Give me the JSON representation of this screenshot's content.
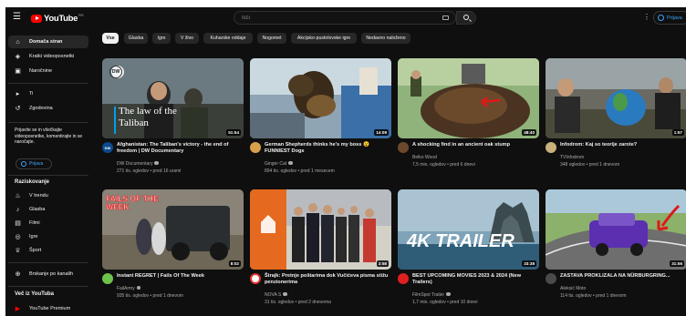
{
  "header": {
    "logo_text": "YouTube",
    "logo_region": "RS",
    "search_placeholder": "Išči",
    "signin_label": "Prijava"
  },
  "sidebar": {
    "items": [
      {
        "label": "Domača stran",
        "icon": "home-icon"
      },
      {
        "label": "Kratki videoposnetki",
        "icon": "shorts-icon"
      },
      {
        "label": "Naročnine",
        "icon": "subscriptions-icon"
      },
      {
        "label": "Ti",
        "icon": "you-icon"
      },
      {
        "label": "Zgodovina",
        "icon": "history-icon"
      }
    ],
    "signin_hint": "Prijavite se in všečkajte videoposnetke, komentirajte in se naročajte.",
    "signin_label": "Prijava",
    "explore_title": "Raziskovanje",
    "explore_items": [
      {
        "label": "V trendu",
        "icon": "trending-icon"
      },
      {
        "label": "Glasba",
        "icon": "music-icon"
      },
      {
        "label": "Filmi",
        "icon": "movies-icon"
      },
      {
        "label": "Igre",
        "icon": "gaming-icon"
      },
      {
        "label": "Šport",
        "icon": "sports-icon"
      }
    ],
    "browse_channels": "Brskanje po kanalih",
    "more_title": "Več iz YouTuba",
    "premium_label": "YouTube Premium"
  },
  "chips": [
    "Vse",
    "Glasba",
    "Igre",
    "V živo",
    "Kuharske oddaje",
    "Nogomet",
    "Akcijsko-pustolovske igre",
    "Nedavno naloženo"
  ],
  "videos": [
    {
      "title": "Afghanistan: The Taliban's victory - the end of freedom | DW Documentary",
      "channel": "DW Documentary",
      "verified": true,
      "meta": "271 tis. ogledov • pred 16 urami",
      "duration": "51:54",
      "thumb_caption": "The law of the Taliban",
      "avatar_text": "DW"
    },
    {
      "title": "German Shepherds thinks he's my boss 😮 FUNNIEST Dogs",
      "channel": "Ginger Cat",
      "verified": true,
      "meta": "894 tis. ogledov • pred 1 mesecem",
      "duration": "14:09"
    },
    {
      "title": "A shocking find in an ancient oak stump",
      "channel": "Belko Wood",
      "verified": false,
      "meta": "7,5 mio. ogledov • pred 6 dnevi",
      "duration": "48:40"
    },
    {
      "title": "Infodrom: Kaj so teorije zarote?",
      "channel": "TVInfodrom",
      "verified": false,
      "meta": "348 ogledov • pred 1 dnevom",
      "duration": "1:57"
    },
    {
      "title": "Instant REGRET | Fails Of The Week",
      "channel": "FailArmy",
      "verified": true,
      "meta": "935 tis. ogledov • pred 1 dnevom",
      "duration": "8:02",
      "thumb_caption": "FAILS OF THE WEEK"
    },
    {
      "title": "Štrajk: Pretnje poštarima dok Vučićeva pisma stižu penzionerima",
      "channel": "NOVA S",
      "verified": true,
      "meta": "31 tis. ogledov • pred 2 dnevoma",
      "duration": "3:58"
    },
    {
      "title": "BEST UPCOMING MOVIES 2023 & 2024 (New Trailers)",
      "channel": "FilmSpot Trailer",
      "verified": true,
      "meta": "1,7 mio. ogledov • pred 10 dnevi",
      "duration": "33:38",
      "thumb_caption": "4K TRAILER"
    },
    {
      "title": "ZASTAVA PROKLIZALA NA NÜRBURGRING...",
      "channel": "Aleksić Moto",
      "verified": false,
      "meta": "114 tis. ogledov • pred 1 dnevom",
      "duration": "31:56"
    }
  ]
}
